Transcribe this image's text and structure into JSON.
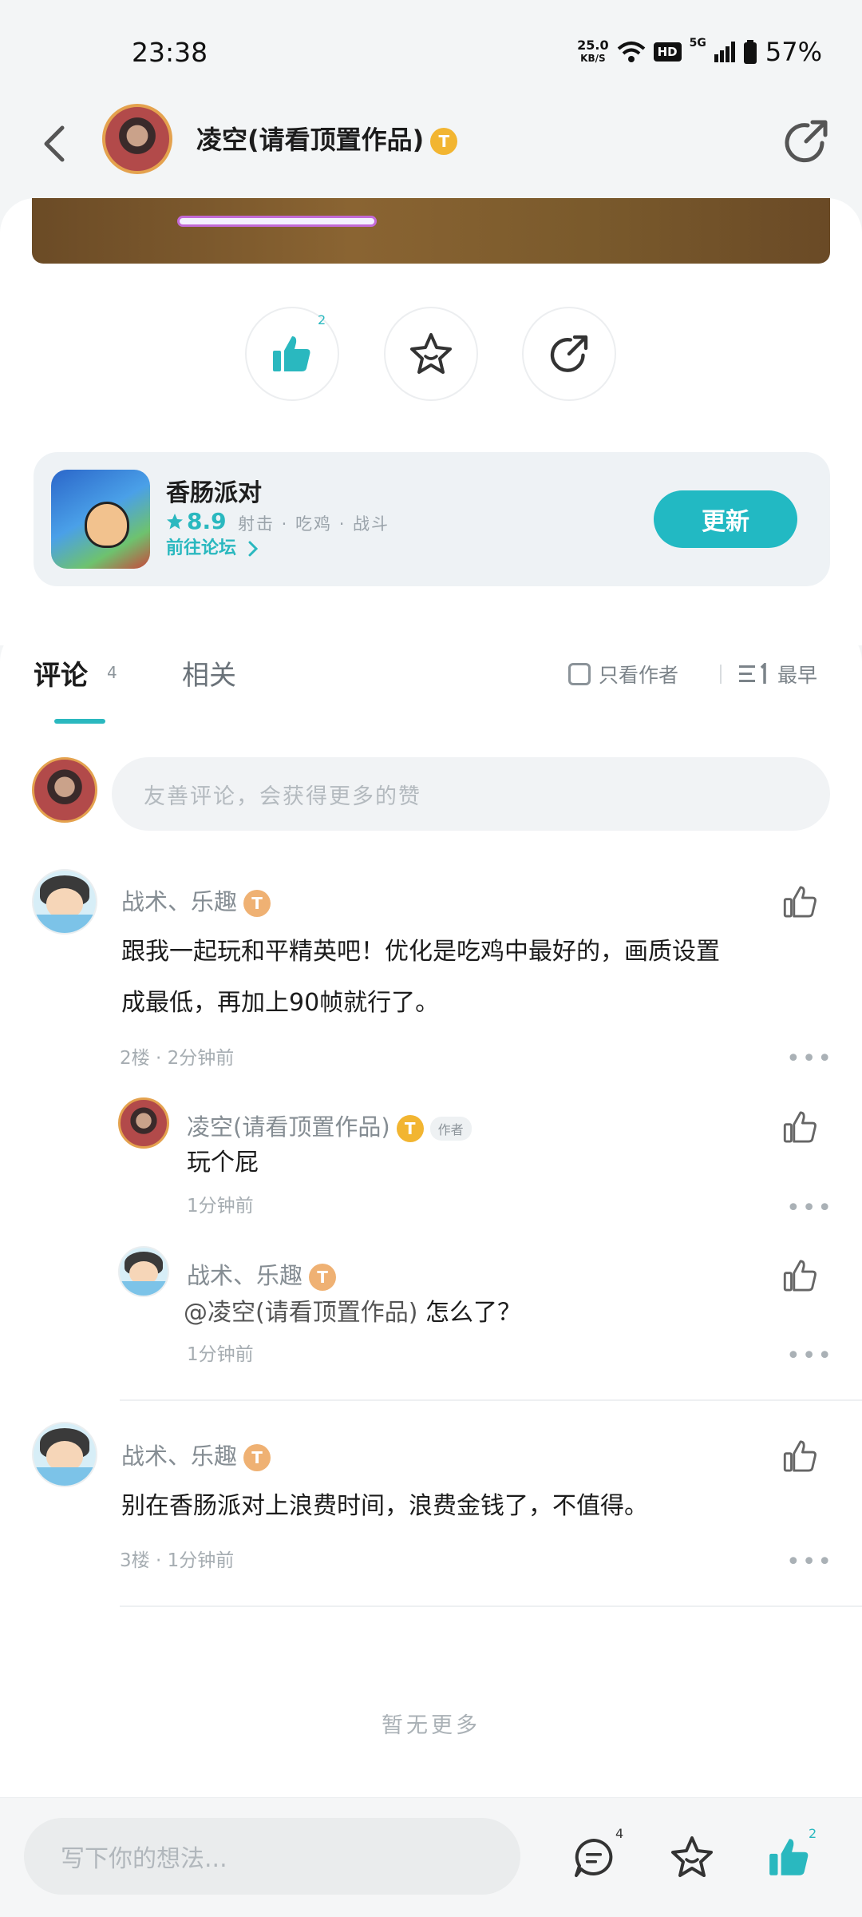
{
  "status_bar": {
    "time": "23:38",
    "net_speed_value": "25.0",
    "net_speed_unit": "KB/S",
    "hd": "HD",
    "network": "5G",
    "battery": "57%"
  },
  "header": {
    "title": "凌空(请看顶置作品)",
    "level": "T"
  },
  "actions": {
    "like_count": "2"
  },
  "game": {
    "name": "香肠派对",
    "rating": "8.9",
    "tags": "射击 · 吃鸡 · 战斗",
    "forum_link": "前往论坛",
    "update_button": "更新"
  },
  "tabs": {
    "comments": "评论",
    "comments_count": "4",
    "related": "相关",
    "only_author": "只看作者",
    "sort": "最早"
  },
  "comment_input_placeholder": "友善评论，会获得更多的赞",
  "comments": [
    {
      "name": "战术、乐趣",
      "text_line1": "跟我一起玩和平精英吧！优化是吃鸡中最好的，画质设置",
      "text_line2": "成最低，再加上90帧就行了。",
      "meta": "2楼 · 2分钟前"
    },
    {
      "name": "凌空(请看顶置作品)",
      "author_tag": "作者",
      "text": "玩个屁",
      "meta": "1分钟前"
    },
    {
      "name": "战术、乐趣",
      "mention": "@凌空(请看顶置作品)",
      "text": "怎么了？",
      "meta": "1分钟前"
    },
    {
      "name": "战术、乐趣",
      "text": "别在香肠派对上浪费时间，浪费金钱了，不值得。",
      "meta": "3楼 · 1分钟前"
    }
  ],
  "no_more": "暂无更多",
  "bottom_bar": {
    "placeholder": "写下你的想法...",
    "comment_count": "4",
    "like_count": "2"
  },
  "colors": {
    "accent": "#2ab8bf",
    "level_gold": "#f2b531",
    "level_orange": "#efb173"
  }
}
